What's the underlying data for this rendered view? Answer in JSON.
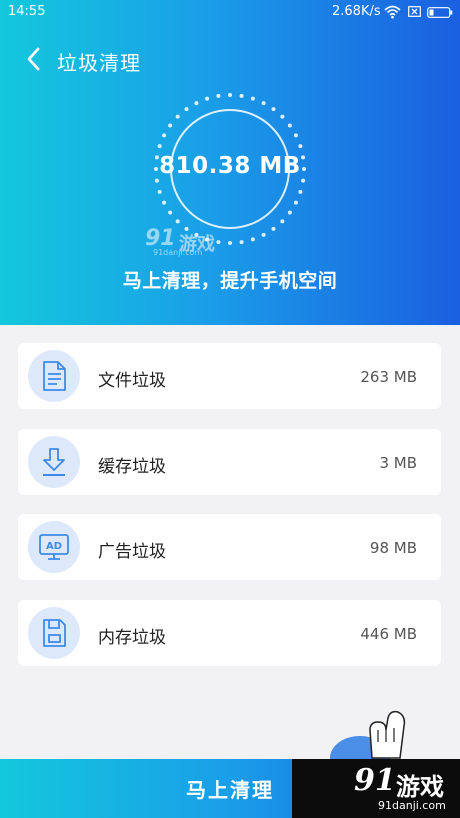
{
  "status_bar": {
    "time": "14:55",
    "net_speed": "2.68K/s"
  },
  "header": {
    "title": "垃圾清理"
  },
  "summary": {
    "total_size": "810.38 MB",
    "tagline": "马上清理，提升手机空间"
  },
  "watermark": {
    "number": "91",
    "name": "游戏",
    "url": "91danji.com"
  },
  "items": [
    {
      "label": "文件垃圾",
      "size": "263 MB",
      "icon": "document-icon"
    },
    {
      "label": "缓存垃圾",
      "size": "3 MB",
      "icon": "download-icon"
    },
    {
      "label": "广告垃圾",
      "size": "98 MB",
      "icon": "ad-monitor-icon"
    },
    {
      "label": "内存垃圾",
      "size": "446 MB",
      "icon": "sd-card-icon"
    }
  ],
  "action": {
    "clean_label": "马上清理"
  },
  "colors": {
    "accent_start": "#13c8dc",
    "accent_end": "#1a5fe0",
    "icon_bg": "#dde9fa",
    "icon_stroke": "#3d8ae8"
  }
}
